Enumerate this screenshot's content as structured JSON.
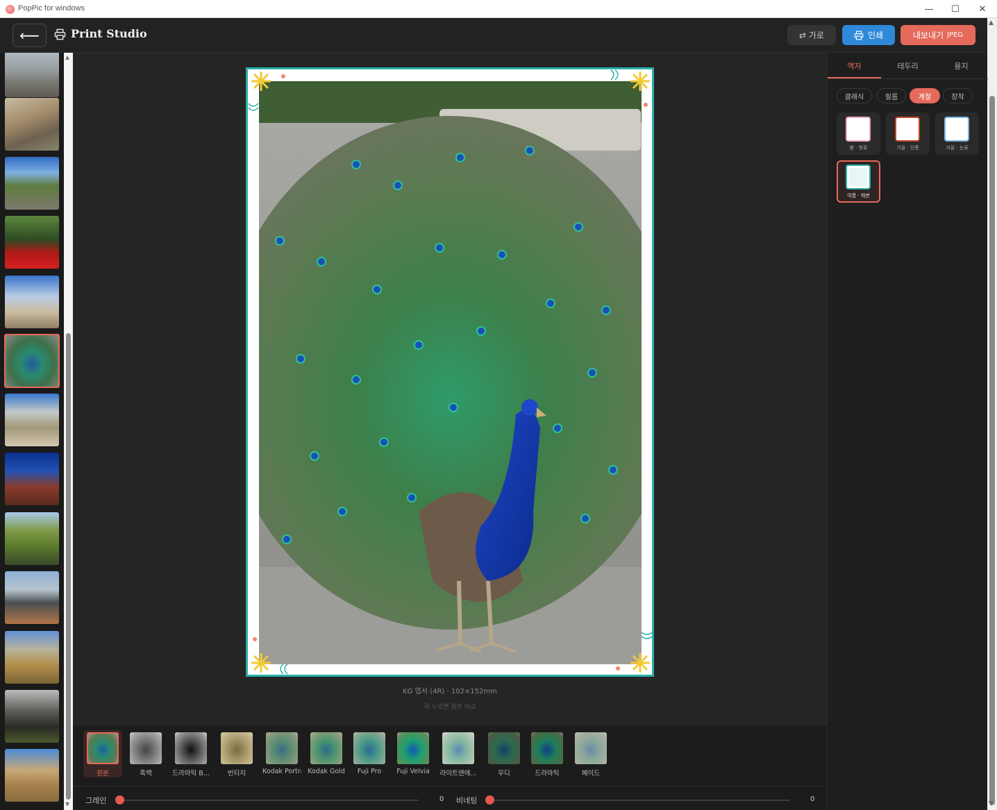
{
  "window": {
    "app_title": "PopPic for windows",
    "min_glyph": "—",
    "max_glyph": "☐",
    "close_glyph": "✕"
  },
  "header": {
    "back_glyph": "⟵",
    "title": "Print Studio",
    "orientation_label": "⇄ 가로",
    "print_label": "인쇄",
    "export_label": "내보내기",
    "export_format": "JPEG",
    "colors": {
      "print": "#2f88d8",
      "export": "#e56a5c"
    }
  },
  "thumbnails": {
    "selected_index": 5,
    "count": 13
  },
  "preview": {
    "frame_color": "#2bb0a8",
    "paper_info": "KG 엽서 (4R) · 102×152mm",
    "compare_hint": "꾹 누르면 원본 비교"
  },
  "filters": {
    "selected_index": 0,
    "items": [
      {
        "label": "원본"
      },
      {
        "label": "흑백"
      },
      {
        "label": "드라마틱 B..."
      },
      {
        "label": "빈티지"
      },
      {
        "label": "Kodak Portra"
      },
      {
        "label": "Kodak Gold"
      },
      {
        "label": "Fuji Pro"
      },
      {
        "label": "Fuji Velvia"
      },
      {
        "label": "라이트앤에..."
      },
      {
        "label": "무디"
      },
      {
        "label": "드라마틱"
      },
      {
        "label": "페이드"
      }
    ]
  },
  "sliders": {
    "grain_label": "그레인",
    "grain_value": "0",
    "vignette_label": "비네팅",
    "vignette_value": "0"
  },
  "panel": {
    "tabs": [
      {
        "label": "액자"
      },
      {
        "label": "테두리"
      },
      {
        "label": "용지"
      }
    ],
    "active_tab": 0,
    "chips": [
      {
        "label": "클래식"
      },
      {
        "label": "필름"
      },
      {
        "label": "계절"
      },
      {
        "label": "장착"
      }
    ],
    "active_chip": 2,
    "tiles": [
      {
        "label": "봄 · 벚꽃",
        "color": "#f3a6c6"
      },
      {
        "label": "가을 · 단풍",
        "color": "#c2481f"
      },
      {
        "label": "겨울 · 눈꽃",
        "color": "#78b6e8"
      },
      {
        "label": "여름 · 해변",
        "color": "#2bb0a8"
      }
    ],
    "selected_tile": 3
  }
}
